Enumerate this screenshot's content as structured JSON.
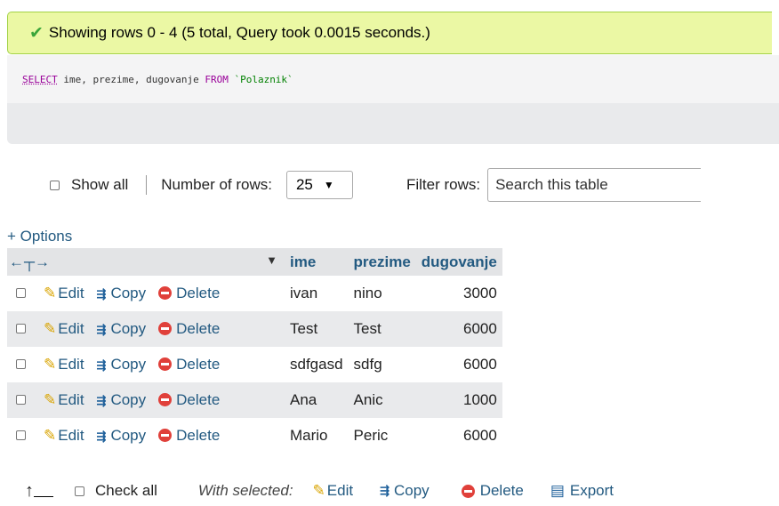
{
  "message": {
    "text": "Showing rows 0 - 4 (5 total, Query took 0.0015 seconds.)"
  },
  "sql": {
    "select": "SELECT",
    "columns": " ime, prezime, dugovanje ",
    "from": "FROM",
    "table": "`Polaznik`"
  },
  "controls": {
    "show_all": "Show all",
    "number_of_rows_label": "Number of rows:",
    "number_of_rows_value": "25",
    "filter_label": "Filter rows:",
    "filter_placeholder": "Search this table"
  },
  "options_link": "+ Options",
  "table": {
    "columns": [
      "ime",
      "prezime",
      "dugovanje"
    ],
    "actions": {
      "edit": "Edit",
      "copy": "Copy",
      "delete": "Delete"
    },
    "rows": [
      [
        "ivan",
        "nino",
        "3000"
      ],
      [
        "Test",
        "Test",
        "6000"
      ],
      [
        "sdfgasd",
        "sdfg",
        "6000"
      ],
      [
        "Ana",
        "Anic",
        "1000"
      ],
      [
        "Mario",
        "Peric",
        "6000"
      ]
    ]
  },
  "bottom": {
    "check_all": "Check all",
    "with_selected": "With selected:",
    "edit": "Edit",
    "copy": "Copy",
    "delete": "Delete",
    "export": "Export"
  },
  "colors": {
    "success_bg": "#ebf8a4",
    "link": "#235a81",
    "row_alt": "#e9eaec"
  }
}
